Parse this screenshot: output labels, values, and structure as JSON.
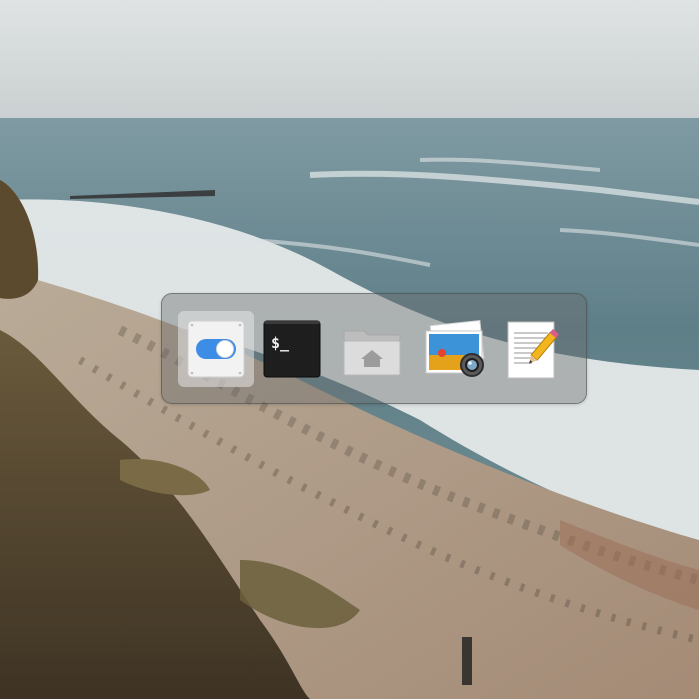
{
  "switcher": {
    "selected_index": 0,
    "apps": [
      {
        "icon": "settings-toggle-icon",
        "selected": true
      },
      {
        "icon": "terminal-icon",
        "glyph": "$_",
        "selected": false
      },
      {
        "icon": "home-folder-icon",
        "selected": false
      },
      {
        "icon": "image-viewer-icon",
        "selected": false
      },
      {
        "icon": "text-editor-icon",
        "selected": false
      }
    ]
  },
  "colors": {
    "selection_highlight": "#e6e6e6",
    "toggle_blue": "#3d8de6",
    "terminal_bg": "#1e1e1e"
  }
}
